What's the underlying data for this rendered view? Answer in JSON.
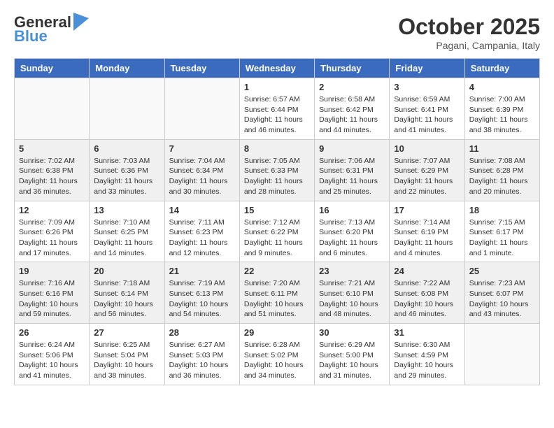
{
  "logo": {
    "line1": "General",
    "line2": "Blue"
  },
  "title": "October 2025",
  "subtitle": "Pagani, Campania, Italy",
  "weekdays": [
    "Sunday",
    "Monday",
    "Tuesday",
    "Wednesday",
    "Thursday",
    "Friday",
    "Saturday"
  ],
  "weeks": [
    [
      {
        "day": "",
        "info": ""
      },
      {
        "day": "",
        "info": ""
      },
      {
        "day": "",
        "info": ""
      },
      {
        "day": "1",
        "info": "Sunrise: 6:57 AM\nSunset: 6:44 PM\nDaylight: 11 hours\nand 46 minutes."
      },
      {
        "day": "2",
        "info": "Sunrise: 6:58 AM\nSunset: 6:42 PM\nDaylight: 11 hours\nand 44 minutes."
      },
      {
        "day": "3",
        "info": "Sunrise: 6:59 AM\nSunset: 6:41 PM\nDaylight: 11 hours\nand 41 minutes."
      },
      {
        "day": "4",
        "info": "Sunrise: 7:00 AM\nSunset: 6:39 PM\nDaylight: 11 hours\nand 38 minutes."
      }
    ],
    [
      {
        "day": "5",
        "info": "Sunrise: 7:02 AM\nSunset: 6:38 PM\nDaylight: 11 hours\nand 36 minutes."
      },
      {
        "day": "6",
        "info": "Sunrise: 7:03 AM\nSunset: 6:36 PM\nDaylight: 11 hours\nand 33 minutes."
      },
      {
        "day": "7",
        "info": "Sunrise: 7:04 AM\nSunset: 6:34 PM\nDaylight: 11 hours\nand 30 minutes."
      },
      {
        "day": "8",
        "info": "Sunrise: 7:05 AM\nSunset: 6:33 PM\nDaylight: 11 hours\nand 28 minutes."
      },
      {
        "day": "9",
        "info": "Sunrise: 7:06 AM\nSunset: 6:31 PM\nDaylight: 11 hours\nand 25 minutes."
      },
      {
        "day": "10",
        "info": "Sunrise: 7:07 AM\nSunset: 6:29 PM\nDaylight: 11 hours\nand 22 minutes."
      },
      {
        "day": "11",
        "info": "Sunrise: 7:08 AM\nSunset: 6:28 PM\nDaylight: 11 hours\nand 20 minutes."
      }
    ],
    [
      {
        "day": "12",
        "info": "Sunrise: 7:09 AM\nSunset: 6:26 PM\nDaylight: 11 hours\nand 17 minutes."
      },
      {
        "day": "13",
        "info": "Sunrise: 7:10 AM\nSunset: 6:25 PM\nDaylight: 11 hours\nand 14 minutes."
      },
      {
        "day": "14",
        "info": "Sunrise: 7:11 AM\nSunset: 6:23 PM\nDaylight: 11 hours\nand 12 minutes."
      },
      {
        "day": "15",
        "info": "Sunrise: 7:12 AM\nSunset: 6:22 PM\nDaylight: 11 hours\nand 9 minutes."
      },
      {
        "day": "16",
        "info": "Sunrise: 7:13 AM\nSunset: 6:20 PM\nDaylight: 11 hours\nand 6 minutes."
      },
      {
        "day": "17",
        "info": "Sunrise: 7:14 AM\nSunset: 6:19 PM\nDaylight: 11 hours\nand 4 minutes."
      },
      {
        "day": "18",
        "info": "Sunrise: 7:15 AM\nSunset: 6:17 PM\nDaylight: 11 hours\nand 1 minute."
      }
    ],
    [
      {
        "day": "19",
        "info": "Sunrise: 7:16 AM\nSunset: 6:16 PM\nDaylight: 10 hours\nand 59 minutes."
      },
      {
        "day": "20",
        "info": "Sunrise: 7:18 AM\nSunset: 6:14 PM\nDaylight: 10 hours\nand 56 minutes."
      },
      {
        "day": "21",
        "info": "Sunrise: 7:19 AM\nSunset: 6:13 PM\nDaylight: 10 hours\nand 54 minutes."
      },
      {
        "day": "22",
        "info": "Sunrise: 7:20 AM\nSunset: 6:11 PM\nDaylight: 10 hours\nand 51 minutes."
      },
      {
        "day": "23",
        "info": "Sunrise: 7:21 AM\nSunset: 6:10 PM\nDaylight: 10 hours\nand 48 minutes."
      },
      {
        "day": "24",
        "info": "Sunrise: 7:22 AM\nSunset: 6:08 PM\nDaylight: 10 hours\nand 46 minutes."
      },
      {
        "day": "25",
        "info": "Sunrise: 7:23 AM\nSunset: 6:07 PM\nDaylight: 10 hours\nand 43 minutes."
      }
    ],
    [
      {
        "day": "26",
        "info": "Sunrise: 6:24 AM\nSunset: 5:06 PM\nDaylight: 10 hours\nand 41 minutes."
      },
      {
        "day": "27",
        "info": "Sunrise: 6:25 AM\nSunset: 5:04 PM\nDaylight: 10 hours\nand 38 minutes."
      },
      {
        "day": "28",
        "info": "Sunrise: 6:27 AM\nSunset: 5:03 PM\nDaylight: 10 hours\nand 36 minutes."
      },
      {
        "day": "29",
        "info": "Sunrise: 6:28 AM\nSunset: 5:02 PM\nDaylight: 10 hours\nand 34 minutes."
      },
      {
        "day": "30",
        "info": "Sunrise: 6:29 AM\nSunset: 5:00 PM\nDaylight: 10 hours\nand 31 minutes."
      },
      {
        "day": "31",
        "info": "Sunrise: 6:30 AM\nSunset: 4:59 PM\nDaylight: 10 hours\nand 29 minutes."
      },
      {
        "day": "",
        "info": ""
      }
    ]
  ]
}
